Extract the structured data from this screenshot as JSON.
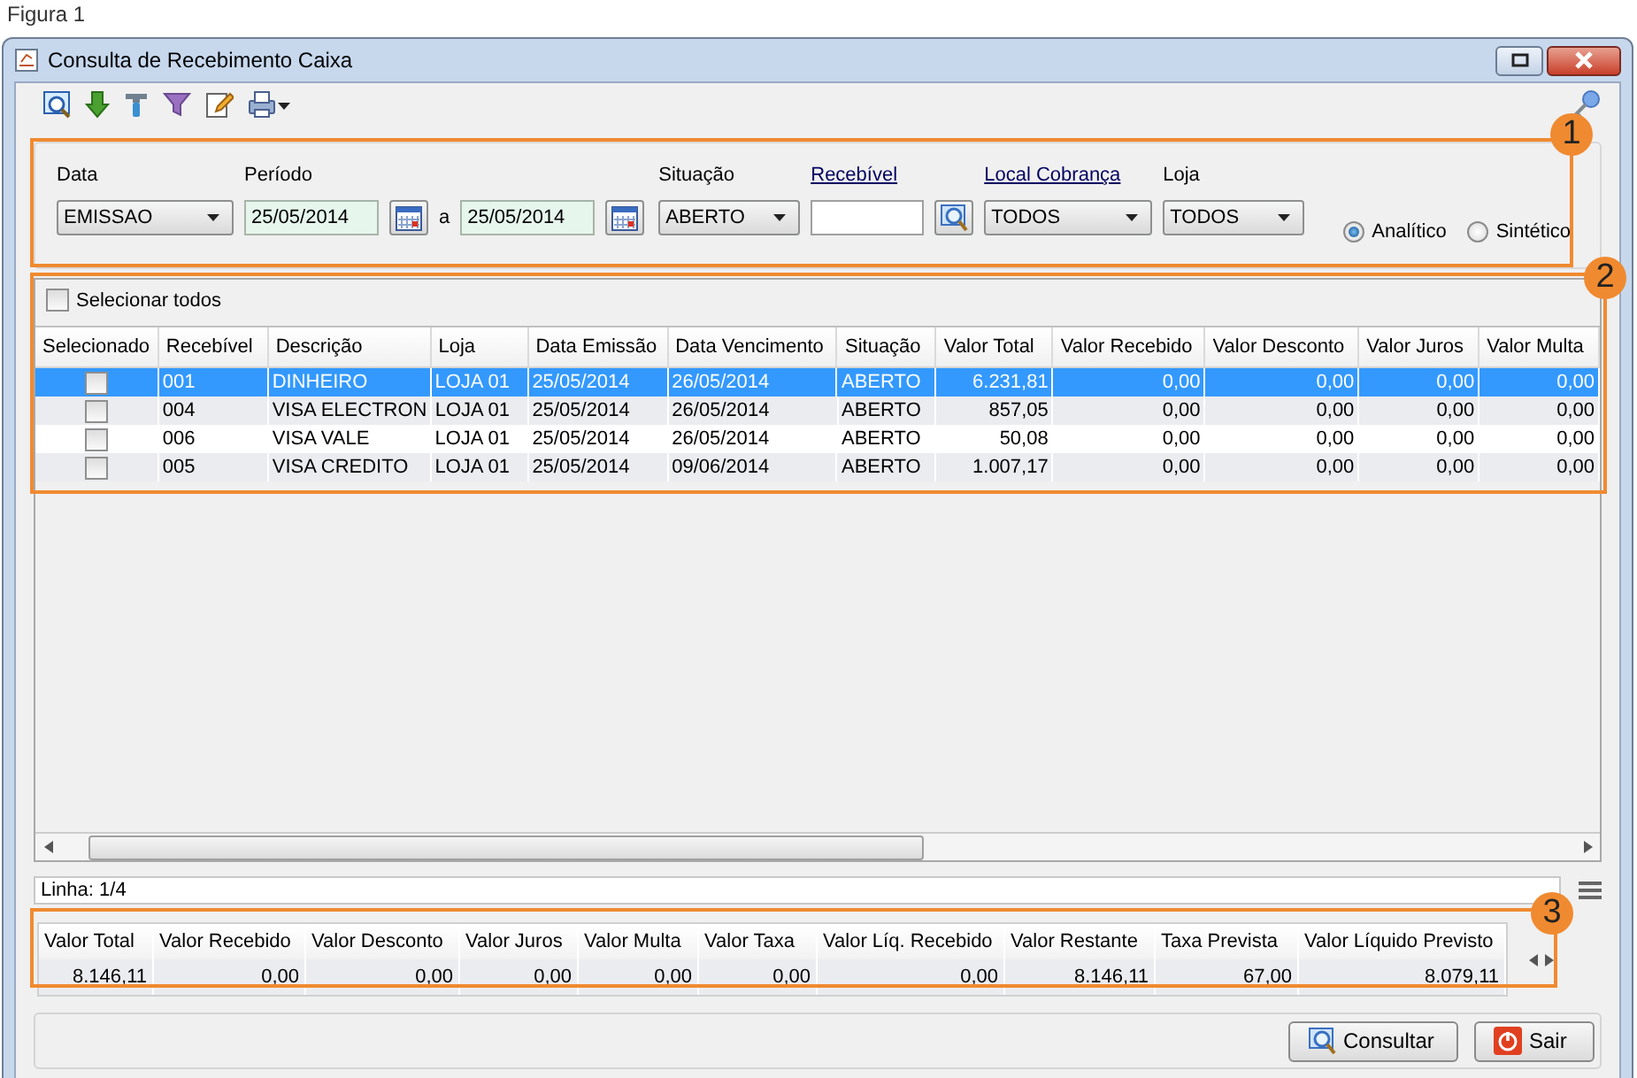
{
  "caption": "Figura 1",
  "window": {
    "title": "Consulta de Recebimento Caixa"
  },
  "filters": [
    {
      "kind": "dropdown",
      "label": "Data",
      "link": false,
      "value": "EMISSAO"
    },
    {
      "kind": "date_range",
      "label": "Período",
      "link": false,
      "from": "25/05/2014",
      "separator": "a",
      "to": "25/05/2014"
    },
    {
      "kind": "dropdown",
      "label": "Situação",
      "link": false,
      "value": "ABERTO"
    },
    {
      "kind": "lookup",
      "label": "Recebível",
      "link": true
    },
    {
      "kind": "dropdown",
      "label": "Local Cobrança",
      "link": true,
      "value": "TODOS"
    },
    {
      "kind": "dropdown",
      "label": "Loja",
      "link": false,
      "value": "TODOS"
    }
  ],
  "modes": [
    {
      "label": "Analítico",
      "selected": true
    },
    {
      "label": "Sintético",
      "selected": false
    }
  ],
  "select_all": {
    "label": "Selecionar todos",
    "checked": false
  },
  "table": {
    "columns": [
      "Selecionado",
      "Recebível",
      "Descrição",
      "Loja",
      "Data Emissão",
      "Data Vencimento",
      "Situação",
      "Valor Total",
      "Valor Recebido",
      "Valor Desconto",
      "Valor Juros",
      "Valor Multa"
    ],
    "rows": [
      {
        "selected": true,
        "checked": false,
        "cells": [
          "",
          "001",
          "DINHEIRO",
          "LOJA 01",
          "25/05/2014",
          "26/05/2014",
          "ABERTO",
          "6.231,81",
          "0,00",
          "0,00",
          "0,00",
          "0,00"
        ]
      },
      {
        "selected": false,
        "checked": false,
        "cells": [
          "",
          "004",
          "VISA ELECTRON",
          "LOJA 01",
          "25/05/2014",
          "26/05/2014",
          "ABERTO",
          "857,05",
          "0,00",
          "0,00",
          "0,00",
          "0,00"
        ]
      },
      {
        "selected": false,
        "checked": false,
        "cells": [
          "",
          "006",
          "VISA VALE",
          "LOJA 01",
          "25/05/2014",
          "26/05/2014",
          "ABERTO",
          "50,08",
          "0,00",
          "0,00",
          "0,00",
          "0,00"
        ]
      },
      {
        "selected": false,
        "checked": false,
        "cells": [
          "",
          "005",
          "VISA CREDITO",
          "LOJA 01",
          "25/05/2014",
          "09/06/2014",
          "ABERTO",
          "1.007,17",
          "0,00",
          "0,00",
          "0,00",
          "0,00"
        ]
      }
    ]
  },
  "status": "Linha: 1/4",
  "totals": {
    "columns": [
      "Valor Total",
      "Valor Recebido",
      "Valor Desconto",
      "Valor Juros",
      "Valor Multa",
      "Valor Taxa",
      "Valor Líq. Recebido",
      "Valor Restante",
      "Taxa Prevista",
      "Valor Líquido Previsto"
    ],
    "values": [
      "8.146,11",
      "0,00",
      "0,00",
      "0,00",
      "0,00",
      "0,00",
      "0,00",
      "8.146,11",
      "67,00",
      "8.079,11"
    ]
  },
  "buttons": [
    {
      "kind": "search",
      "label": "Consultar"
    },
    {
      "kind": "exit",
      "label": "Sair"
    }
  ],
  "callouts": [
    "1",
    "2",
    "3"
  ]
}
